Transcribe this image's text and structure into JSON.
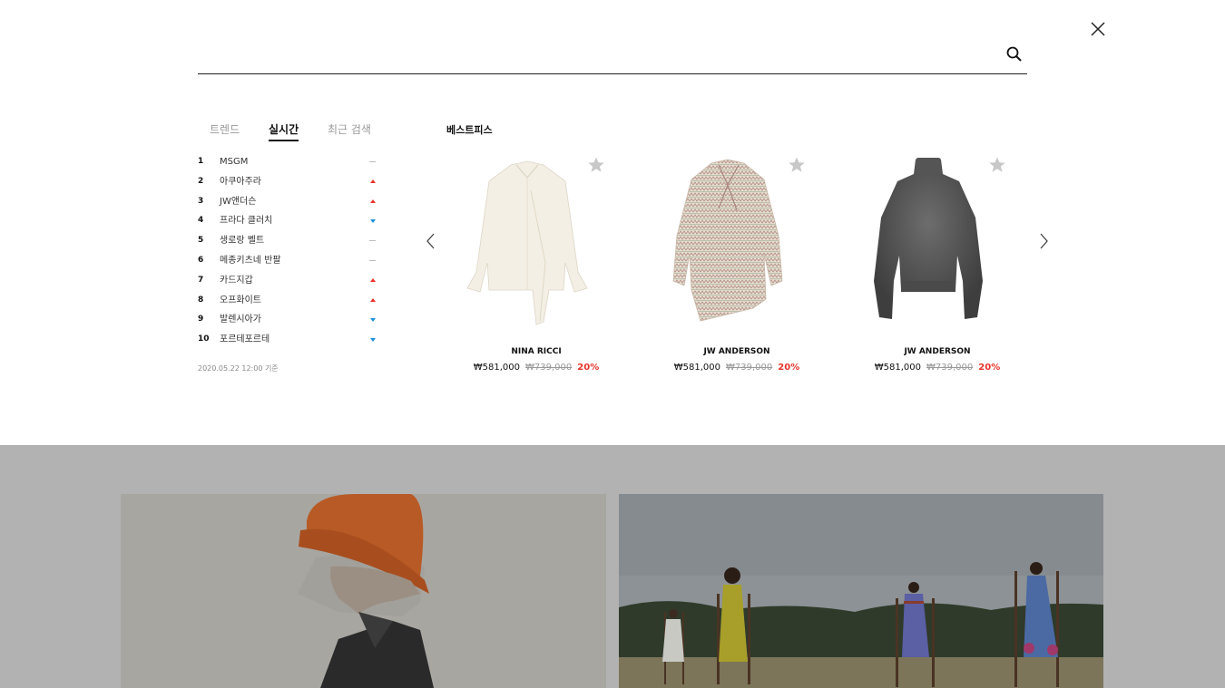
{
  "search": {
    "value": "",
    "placeholder": ""
  },
  "tabs": [
    {
      "label": "트렌드",
      "active": false
    },
    {
      "label": "실시간",
      "active": true
    },
    {
      "label": "최근 검색",
      "active": false
    }
  ],
  "ranking": {
    "items": [
      {
        "rank": "1",
        "name": "MSGM",
        "trend": "same"
      },
      {
        "rank": "2",
        "name": "아쿠아주라",
        "trend": "up"
      },
      {
        "rank": "3",
        "name": "JW앤더슨",
        "trend": "up"
      },
      {
        "rank": "4",
        "name": "프라다 클러치",
        "trend": "down"
      },
      {
        "rank": "5",
        "name": "생로랑 벨트",
        "trend": "same"
      },
      {
        "rank": "6",
        "name": "메종키츠네 반팔",
        "trend": "same"
      },
      {
        "rank": "7",
        "name": "카드지갑",
        "trend": "up"
      },
      {
        "rank": "8",
        "name": "오프화이트",
        "trend": "up"
      },
      {
        "rank": "9",
        "name": "발렌시아가",
        "trend": "down"
      },
      {
        "rank": "10",
        "name": "포르테포르테",
        "trend": "down"
      }
    ],
    "timestamp": "2020.05.22 12:00 기준"
  },
  "best": {
    "title": "베스트피스",
    "products": [
      {
        "brand": "NINA RICCI",
        "price": "₩581,000",
        "original": "₩739,000",
        "discount": "20%",
        "image": "ivory-blouse"
      },
      {
        "brand": "JW ANDERSON",
        "price": "₩581,000",
        "original": "₩739,000",
        "discount": "20%",
        "image": "printed-blouse"
      },
      {
        "brand": "JW ANDERSON",
        "price": "₩581,000",
        "original": "₩739,000",
        "discount": "20%",
        "image": "grey-sweater"
      }
    ]
  },
  "icons": {
    "close": "close-icon",
    "search": "search-icon",
    "favorite": "star-icon",
    "prev": "chevron-left-icon",
    "next": "chevron-right-icon"
  },
  "colors": {
    "trend_up": "#e8332a",
    "trend_down": "#1e90d8",
    "discount": "#e8332a",
    "overlay": "#b2b2b2"
  }
}
